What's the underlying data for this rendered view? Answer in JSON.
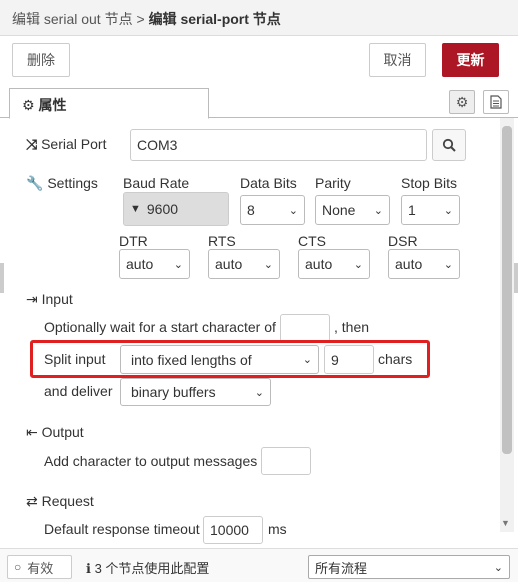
{
  "breadcrumb": {
    "parent": "编辑 serial out 节点",
    "separator": ">",
    "current": "编辑 serial-port 节点"
  },
  "toolbar": {
    "delete_label": "删除",
    "cancel_label": "取消",
    "update_label": "更新"
  },
  "tabs": {
    "properties_label": "属性"
  },
  "serial_port": {
    "label": "Serial Port",
    "value": "COM3"
  },
  "settings": {
    "label": "Settings",
    "baud_rate": {
      "label": "Baud Rate",
      "value": "9600"
    },
    "data_bits": {
      "label": "Data Bits",
      "value": "8"
    },
    "parity": {
      "label": "Parity",
      "value": "None"
    },
    "stop_bits": {
      "label": "Stop Bits",
      "value": "1"
    },
    "dtr": {
      "label": "DTR",
      "value": "auto"
    },
    "rts": {
      "label": "RTS",
      "value": "auto"
    },
    "cts": {
      "label": "CTS",
      "value": "auto"
    },
    "dsr": {
      "label": "DSR",
      "value": "auto"
    }
  },
  "input_section": {
    "label": "Input",
    "wait_text": "Optionally wait for a start character of",
    "then_text": ", then",
    "wait_value": "",
    "split_label": "Split input",
    "split_value": "into fixed lengths of",
    "split_count": "9",
    "chars_text": "chars",
    "deliver_label": "and deliver",
    "deliver_value": "binary buffers"
  },
  "output_section": {
    "label": "Output",
    "add_char_text": "Add character to output messages",
    "add_char_value": ""
  },
  "request_section": {
    "label": "Request",
    "timeout_text": "Default response timeout",
    "timeout_value": "10000",
    "timeout_unit": "ms"
  },
  "footer": {
    "enabled_label": "有效",
    "usage_text": "3 个节点使用此配置",
    "flow_select_value": "所有流程"
  },
  "colors": {
    "accent": "#ad1625",
    "highlight": "#e02020"
  }
}
